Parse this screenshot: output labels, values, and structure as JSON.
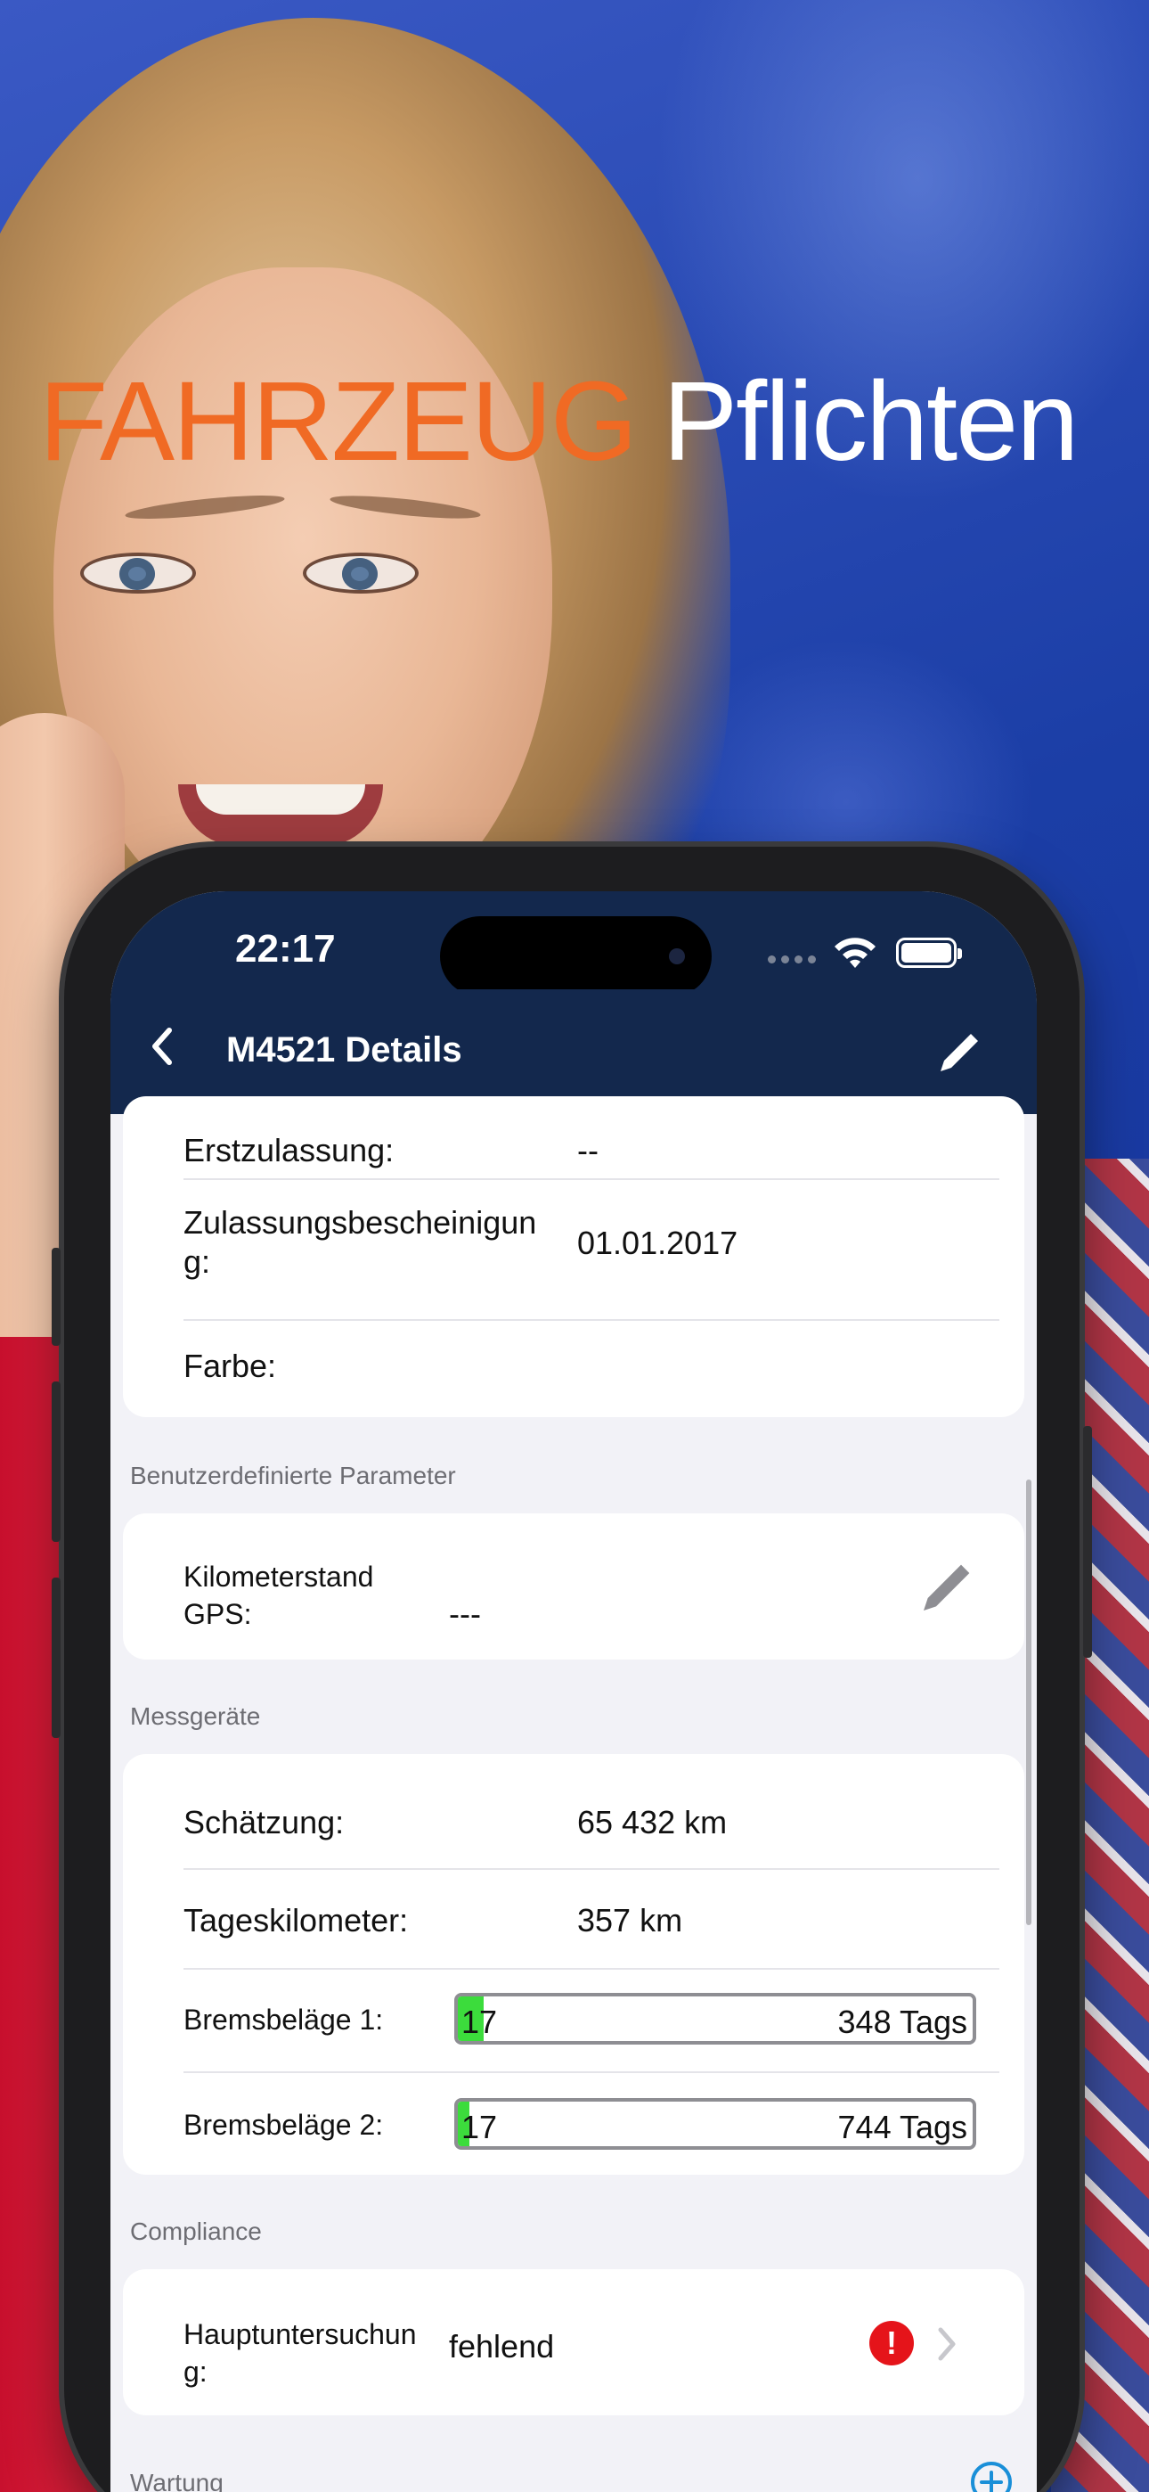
{
  "headline": {
    "word1": "FAHRZEUG",
    "word2": "Pflichten"
  },
  "status": {
    "time": "22:17"
  },
  "nav": {
    "title": "M4521 Details"
  },
  "vehicle": {
    "rows": [
      {
        "label": "Erstzulassung:",
        "value": "--"
      },
      {
        "label": "Zulassungsbescheinigun\ng:",
        "value": "01.01.2017"
      },
      {
        "label": "Farbe:",
        "value": ""
      }
    ]
  },
  "custom_params": {
    "header": "Benutzerdefinierte Parameter",
    "label": "Kilometerstand\nGPS:",
    "value": "---"
  },
  "meters": {
    "header": "Messgeräte",
    "estimate_label": "Schätzung:",
    "estimate_value": "65 432 km",
    "daily_label": "Tageskilometer:",
    "daily_value": "357 km",
    "brake1_label": "Bremsbeläge 1:",
    "brake1_left": "17",
    "brake1_right": "348 Tags",
    "brake1_fill": 0.05,
    "brake2_label": "Bremsbeläge 2:",
    "brake2_left": "17",
    "brake2_right": "744 Tags",
    "brake2_fill": 0.023,
    "fill_color": "#3cdc3c"
  },
  "compliance": {
    "header": "Compliance",
    "label": "Hauptuntersuchun\ng:",
    "value": "fehlend",
    "alert": "!"
  },
  "maintenance": {
    "header": "Wartung"
  }
}
